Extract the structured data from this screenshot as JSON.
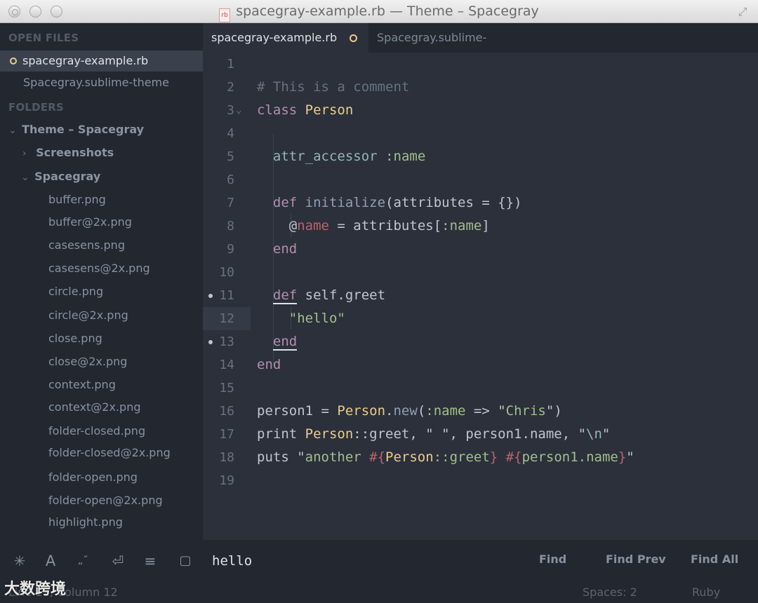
{
  "window": {
    "title": "spacegray-example.rb — Theme – Spacegray",
    "file_badge": "rb"
  },
  "sidebar": {
    "open_files_header": "OPEN FILES",
    "open_files": [
      "spacegray-example.rb",
      "Spacegray.sublime-theme"
    ],
    "folders_header": "FOLDERS",
    "root_folder": "Theme – Spacegray",
    "subfolder_collapsed": "Screenshots",
    "subfolder_open": "Spacegray",
    "files": [
      "buffer.png",
      "buffer@2x.png",
      "casesens.png",
      "casesens@2x.png",
      "circle.png",
      "circle@2x.png",
      "close.png",
      "close@2x.png",
      "context.png",
      "context@2x.png",
      "folder-closed.png",
      "folder-closed@2x.png",
      "folder-open.png",
      "folder-open@2x.png",
      "highlight.png"
    ]
  },
  "tabs": {
    "active": "spacegray-example.rb",
    "inactive": "Spacegray.sublime-theme"
  },
  "editor": {
    "line_numbers": [
      "1",
      "2",
      "3",
      "4",
      "5",
      "6",
      "7",
      "8",
      "9",
      "10",
      "11",
      "12",
      "13",
      "14",
      "15",
      "16",
      "17",
      "18",
      "19"
    ],
    "code": {
      "l2": "# This is a comment",
      "l3_kw": "class",
      "l3_cls": "Person",
      "l5_attr": "attr_accessor",
      "l5_sym": ":name",
      "l7_kw": "def",
      "l7_fn": "initialize",
      "l7_rest": "(attributes = {})",
      "l8_at": "@",
      "l8_ivar": "name",
      "l8_eq": " = attributes[",
      "l8_sym": ":name",
      "l8_close": "]",
      "l9_kw": "end",
      "l11_kw": "def",
      "l11_rest": "self.greet",
      "l12_q1": "\"",
      "l12_str": "hello",
      "l12_q2": "\"",
      "l13_kw": "end",
      "l14_kw": "end",
      "l16_a": "person1 = ",
      "l16_cls": "Person",
      "l16_dot": ".",
      "l16_fn": "new",
      "l16_p": "(",
      "l16_sym": ":name",
      "l16_arrow": " => \"",
      "l16_str": "Chris",
      "l16_end": "\")",
      "l17_a": "print ",
      "l17_cls": "Person",
      "l17_b": "::greet, \" \", person1.name, \"",
      "l17_str": "\\n",
      "l17_c": "\"",
      "l18_a": "puts \"",
      "l18_str1": "another ",
      "l18_i1": "#{",
      "l18_cls": "Person",
      "l18_g": "::greet",
      "l18_i2": "}",
      "l18_sp": " ",
      "l18_i3": "#{",
      "l18_pn": "person1.name",
      "l18_i4": "}",
      "l18_q": "\""
    }
  },
  "find": {
    "query": "hello",
    "find": "Find",
    "find_prev": "Find Prev",
    "find_all": "Find All"
  },
  "status": {
    "line": "Line 12, Column 12",
    "spaces": "Spaces: 2",
    "syntax": "Ruby",
    "watermark": "大数跨境"
  },
  "icons": [
    "regex-icon",
    "case-sensitive-icon",
    "whole-word-icon",
    "wrap-icon",
    "in-selection-icon",
    "highlight-matches-icon",
    "fullscreen-icon"
  ]
}
